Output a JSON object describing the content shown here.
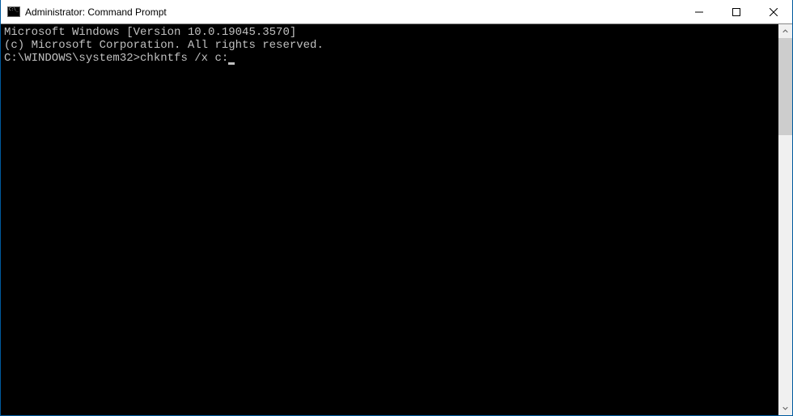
{
  "window": {
    "title": "Administrator: Command Prompt"
  },
  "terminal": {
    "line1": "Microsoft Windows [Version 10.0.19045.3570]",
    "line2": "(c) Microsoft Corporation. All rights reserved.",
    "blank": "",
    "prompt": "C:\\WINDOWS\\system32>",
    "command": "chkntfs /x c:"
  }
}
